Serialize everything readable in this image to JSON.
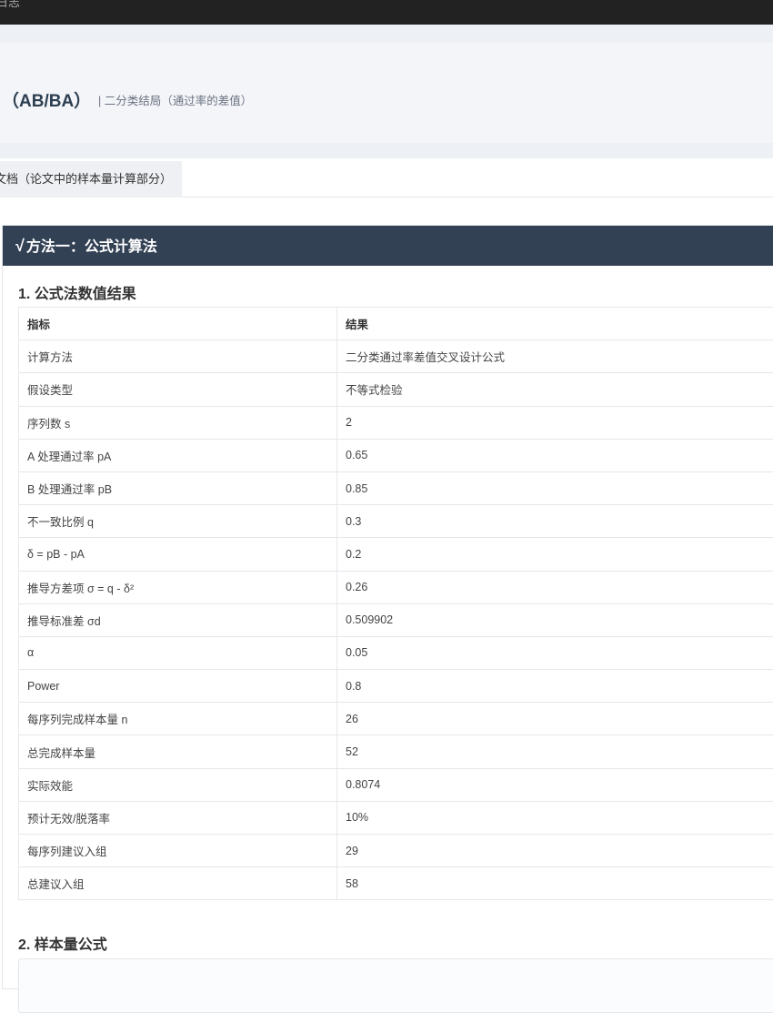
{
  "topbar": {
    "text": "日志"
  },
  "header": {
    "title": "（AB/BA）",
    "subtitle": "| 二分类结局（通过率的差值）"
  },
  "tab": {
    "label": "文档（论文中的样本量计算部分）"
  },
  "card": {
    "icon": "square-root-icon",
    "title": "方法一：公式计算法",
    "section1_title": "1. 公式法数值结果",
    "section2_title": "2. 样本量公式"
  },
  "table": {
    "headers": [
      "指标",
      "结果"
    ],
    "rows": [
      [
        "计算方法",
        "二分类通过率差值交叉设计公式"
      ],
      [
        "假设类型",
        "不等式检验"
      ],
      [
        "序列数 s",
        "2"
      ],
      [
        "A 处理通过率 pA",
        "0.65"
      ],
      [
        "B 处理通过率 pB",
        "0.85"
      ],
      [
        "不一致比例 q",
        "0.3"
      ],
      [
        "δ = pB - pA",
        "0.2"
      ],
      [
        "推导方差项 σ = q - δ²",
        "0.26"
      ],
      [
        "推导标准差 σd",
        "0.509902"
      ],
      [
        "α",
        "0.05"
      ],
      [
        "Power",
        "0.8"
      ],
      [
        "每序列完成样本量 n",
        "26"
      ],
      [
        "总完成样本量",
        "52"
      ],
      [
        "实际效能",
        "0.8074"
      ],
      [
        "预计无效/脱落率",
        "10%"
      ],
      [
        "每序列建议入组",
        "29"
      ],
      [
        "总建议入组",
        "58"
      ]
    ]
  }
}
